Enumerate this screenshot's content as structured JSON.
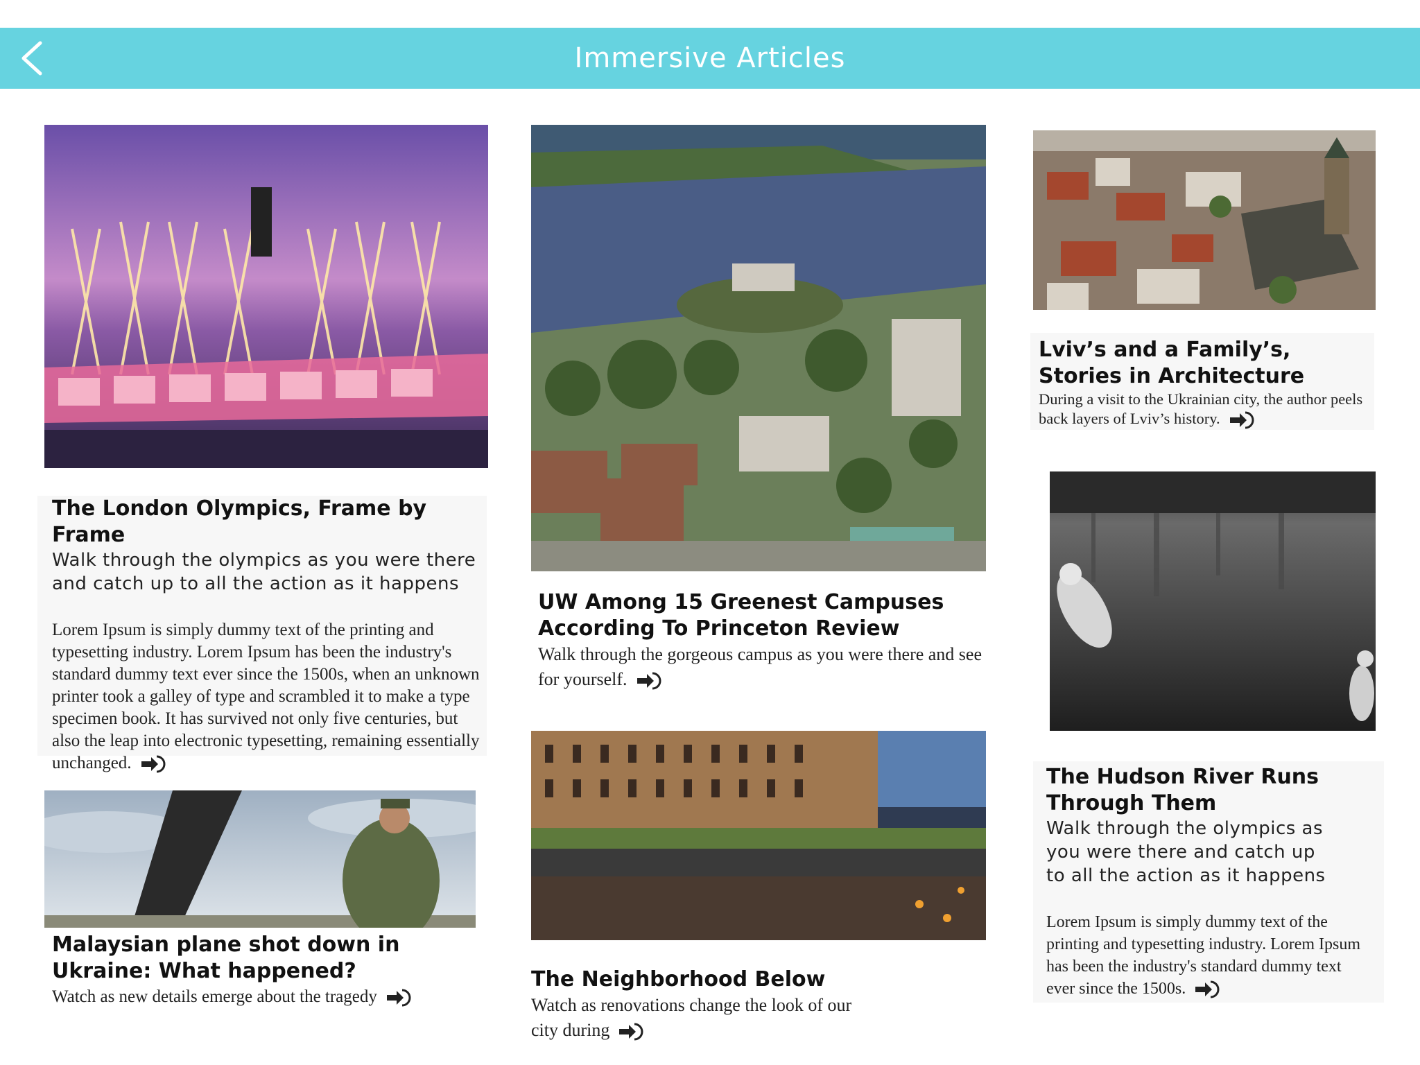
{
  "header": {
    "title": "Immersive Articles",
    "back_icon": "chevron-left-icon",
    "bar_color": "#66d3e0"
  },
  "articles": [
    {
      "title": "The London Olympics, Frame by Frame",
      "subtitle": "Walk through the olympics as you were there and catch up to all the action as it happens",
      "body": "Lorem Ipsum is simply dummy text of the printing and typesetting industry. Lorem Ipsum has been the industry's standard dummy text ever since the 1500s, when an unknown printer took a galley of type and scrambled it to make a type specimen book. It has survived not only five centuries, but also the leap into electronic typesetting, remaining essentially unchanged.",
      "image": "olympics-fireworks-photo"
    },
    {
      "title": "Malaysian plane shot down in Ukraine: What happened?",
      "subtitle": "Watch as new details emerge about the tragedy",
      "image": "crash-site-soldier-photo"
    },
    {
      "title": "UW Among 15 Greenest Campuses According To Princeton Review",
      "subtitle": "Walk through the gorgeous campus as you were there and see for yourself.",
      "image": "campus-aerial-photo"
    },
    {
      "title": "The Neighborhood Below",
      "subtitle": "Watch as renovations change the look of our city during",
      "image": "high-line-street-photo"
    },
    {
      "title": "Lviv’s and a Family’s, Stories in Architecture",
      "subtitle": "During a visit to the Ukrainian city, the author peels back layers of Lviv’s history.",
      "image": "lviv-rooftops-photo"
    },
    {
      "title": "The Hudson River Runs Through Them",
      "subtitle": "Walk through the olympics as you were there and catch up to all the action as it happens",
      "body": "Lorem Ipsum is simply dummy text of the printing and typesetting industry. Lorem Ipsum has been the industry's standard dummy text ever since the 1500s.",
      "image": "river-jumping-photo"
    }
  ],
  "read_more_icon": "arrow-circle-icon"
}
